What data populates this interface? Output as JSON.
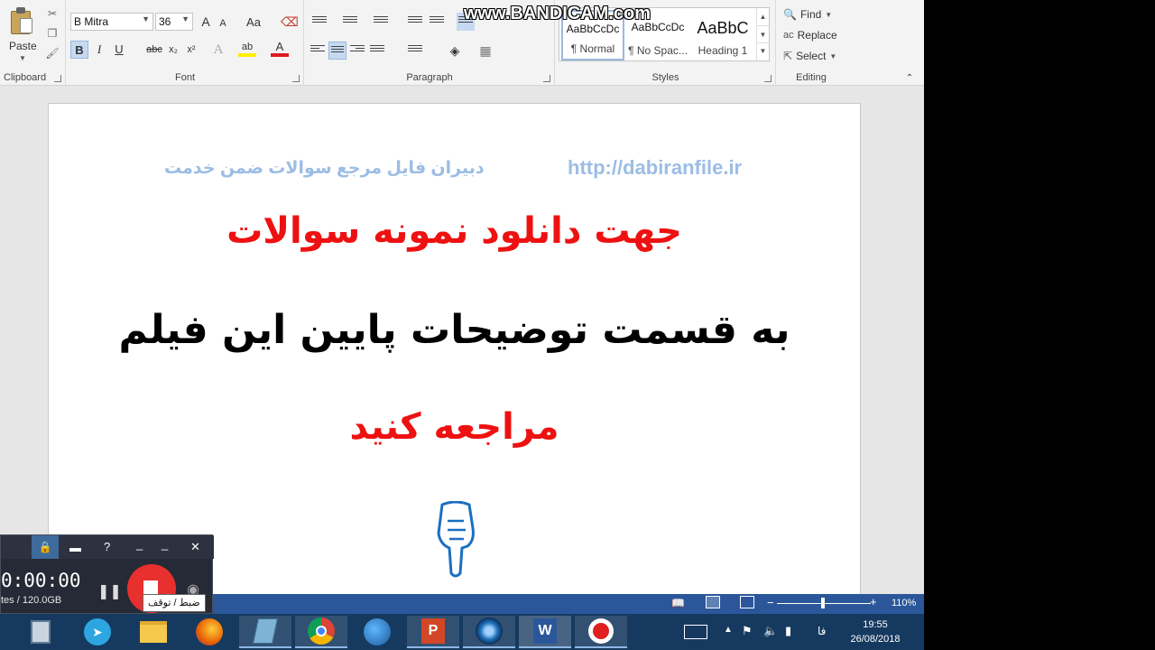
{
  "ribbon": {
    "clipboard": {
      "paste_label": "Paste",
      "group_label": "Clipboard"
    },
    "font": {
      "font_name": "B Mitra",
      "font_size": "36",
      "group_label": "Font",
      "bold": "B",
      "italic": "I",
      "underline": "U",
      "strike": "abc",
      "subscript": "x₂",
      "superscript": "x²",
      "grow": "A",
      "shrink": "A",
      "case": "Aa",
      "color_letter": "A",
      "highlight_letter": "ab"
    },
    "paragraph": {
      "group_label": "Paragraph"
    },
    "styles": {
      "group_label": "Styles",
      "items": [
        {
          "sample": "AaBbCcDc",
          "name": "¶ Normal"
        },
        {
          "sample": "AaBbCcDc",
          "name": "¶ No Spac..."
        },
        {
          "sample": "AaBbC",
          "name": "Heading 1"
        }
      ]
    },
    "editing": {
      "group_label": "Editing",
      "find": "Find",
      "replace": "Replace",
      "select": "Select"
    }
  },
  "watermark": "www.BANDICAM.com",
  "document": {
    "header_url": "http://dabiranfile.ir",
    "header_text": "دبیران فایل مرجع سوالات ضمن خدمت",
    "line1": "جهت دانلود نمونه سوالات",
    "line2": "به قسمت توضیحات پایین این فیلم",
    "line3": "مراجعه کنید"
  },
  "statusbar": {
    "zoom": "110%"
  },
  "recorder": {
    "timer": "0:00:00",
    "size": "tes / 120.0GB",
    "tooltip": "ضبط / توقف",
    "help": "?",
    "minimize": "_",
    "close": "✕"
  },
  "taskbar": {
    "clock_time": "19:55",
    "clock_date": "26/08/2018",
    "lang": "فا"
  },
  "colors": {
    "accent": "#2b579a",
    "taskbar": "#16395f",
    "red_text": "#ee1111",
    "header_blue": "#9cbde4"
  }
}
